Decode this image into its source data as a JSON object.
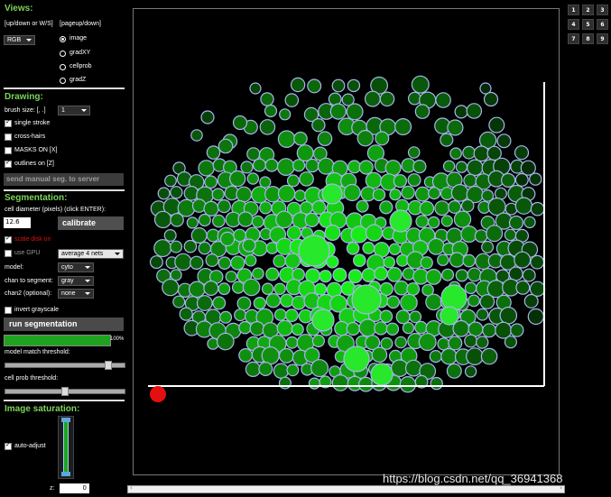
{
  "views": {
    "title": "Views:",
    "hint_left": "[up/down or W/S]",
    "hint_right": "[pageup/down]",
    "color_mode": "RGB",
    "options": [
      "image",
      "gradXY",
      "cellprob",
      "gradZ"
    ],
    "selected": "image"
  },
  "drawing": {
    "title": "Drawing:",
    "brush_label": "brush size: [, .]",
    "brush_value": "1",
    "single_stroke": "single stroke",
    "cross_hairs": "cross-hairs",
    "masks_on": "MASKS ON [X]",
    "outlines_on": "outlines on [Z]",
    "send_button": "send manual seg. to server"
  },
  "segmentation": {
    "title": "Segmentation:",
    "diameter_label": "cell diameter (pixels) (click ENTER):",
    "diameter_value": "12.6",
    "calibrate_button": "calibrate",
    "scale_disk": "scale disk on",
    "use_gpu": "use GPU",
    "nets_value": "average 4 nets",
    "model_label": "model:",
    "model_value": "cyto",
    "chan_label": "chan to segment:",
    "chan_value": "gray",
    "chan2_label": "chan2 (optional):",
    "chan2_value": "none",
    "invert": "invert grayscale",
    "run_button": "run segmentation",
    "progress": 100,
    "progress_label": "100%",
    "threshold_label": "model match threshold:",
    "threshold_level": 0.88,
    "cellprob_label": "cell prob threshold:",
    "cellprob_level": 0.5
  },
  "saturation": {
    "title": "Image saturation:",
    "auto_adjust": "auto-adjust",
    "z_label": "z:",
    "z_value": "0"
  },
  "numpad": [
    "1",
    "2",
    "3",
    "4",
    "5",
    "6",
    "7",
    "8",
    "9"
  ],
  "watermark": "https://blog.csdn.net/qq_36941368",
  "colors": {
    "header": "#7dd35a",
    "progress": "#1fa31f",
    "scale_disk": "#e01010",
    "outline": "#aab4ee",
    "cell": "#1fc31f"
  }
}
